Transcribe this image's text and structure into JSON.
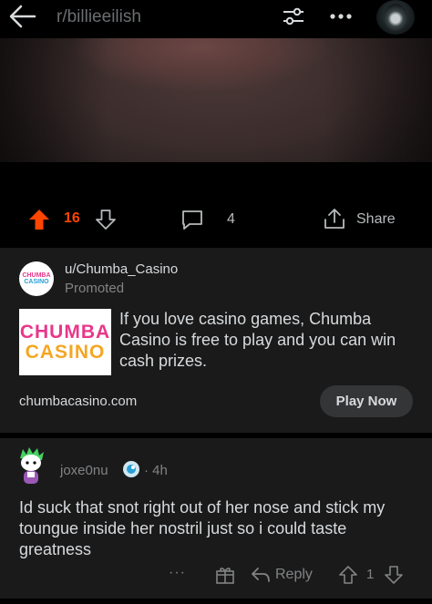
{
  "header": {
    "subreddit": "r/billieeilish",
    "icons": [
      "back-arrow-icon",
      "filter-icon",
      "more-icon",
      "user-avatar"
    ]
  },
  "post": {
    "upvotes": "16",
    "comments": "4",
    "share_label": "Share",
    "upvote_color": "#ff4500"
  },
  "ad": {
    "username": "u/Chumba_Casino",
    "promoted_label": "Promoted",
    "logo_line1": "CHUMBA",
    "logo_line2": "CASINO",
    "text": "If you love casino games, Chumba Casino is free to play and you can win cash prizes.",
    "domain": "chumbacasino.com",
    "cta": "Play Now"
  },
  "comment": {
    "username": "joxe0nu",
    "separator": "·",
    "time": "4h",
    "body": "Id suck that snot right out of her nose and stick my toungue inside her nostril just so i could taste greatness",
    "more_label": "···",
    "reply_label": "Reply",
    "score": "1"
  },
  "colors": {
    "background": "#000000",
    "card": "#1a1a1b",
    "text": "#d7dadc",
    "muted": "#818384",
    "accent": "#ff4500"
  }
}
